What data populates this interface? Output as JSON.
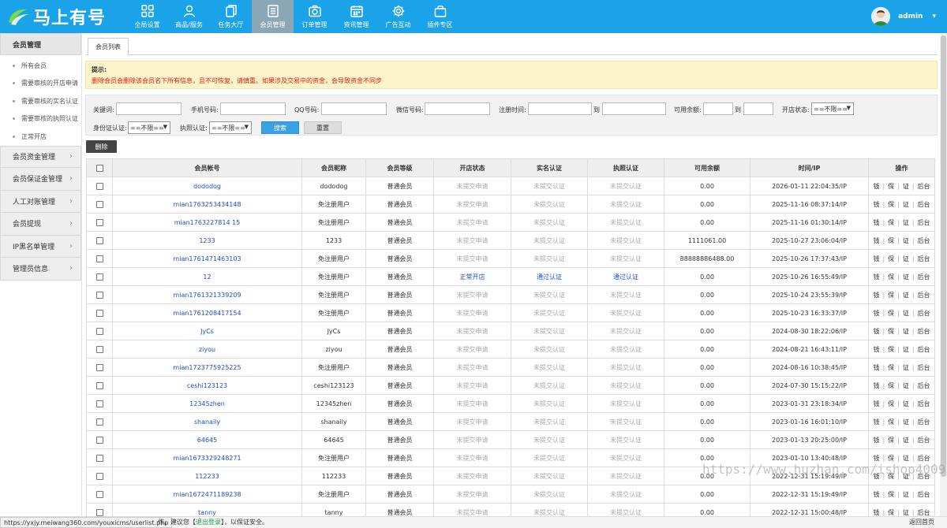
{
  "app": {
    "logo_text": "马上有号",
    "brand_color": "#1aa3e8"
  },
  "nav": [
    {
      "label": "全局设置",
      "icon": "grid-icon"
    },
    {
      "label": "商品/服务",
      "icon": "user-icon"
    },
    {
      "label": "任务大厅",
      "icon": "copy-icon"
    },
    {
      "label": "会员管理",
      "icon": "document-icon",
      "active": true
    },
    {
      "label": "订单管理",
      "icon": "camera-icon"
    },
    {
      "label": "资讯管理",
      "icon": "calendar-icon"
    },
    {
      "label": "广告互动",
      "icon": "gear-icon"
    },
    {
      "label": "插件专区",
      "icon": "bag-icon"
    }
  ],
  "user": {
    "name": "admin"
  },
  "sidebar": {
    "head": "会员管理",
    "subitems": [
      "所有会员",
      "需要审核的开店申请",
      "需要审核的实名认证",
      "需要审核的执照认证",
      "正常开店"
    ],
    "groups": [
      "会员资金管理",
      "会员保证金管理",
      "人工对账管理",
      "会员提现",
      "IP黑名单管理",
      "管理员信息"
    ]
  },
  "tab": {
    "label": "会员列表"
  },
  "notice": {
    "title": "提示:",
    "text": "删除会员会删除该会员名下所有信息，且不可恢复，请慎重。如果涉及交易中的资金，会导致资金不同步"
  },
  "filter": {
    "keyword_label": "关键词:",
    "phone_label": "手机号码:",
    "qq_label": "QQ号码:",
    "wechat_label": "微信号码:",
    "regtime_label": "注册时间:",
    "to1": "到",
    "balance_label": "可用余额:",
    "to2": "到",
    "shop_label": "开店状态:",
    "shop_value": "==不限==",
    "idcert_label": "身份证认证:",
    "idcert_value": "==不限==",
    "license_label": "执照认证:",
    "license_value": "==不限==",
    "search": "搜索",
    "reset": "重置"
  },
  "delete_label": "删除",
  "table": {
    "headers": [
      "会员帐号",
      "会员昵称",
      "会员等级",
      "开店状态",
      "实名认证",
      "执照认证",
      "可用余额",
      "时间/IP",
      "操作"
    ],
    "ops": [
      "钱",
      "保",
      "证",
      "后台"
    ],
    "rows": [
      {
        "account": "dododog",
        "nick": "dododog",
        "level": "普通会员",
        "shop": "未提交申请",
        "real": "未提交认证",
        "license": "未提交认证",
        "balance": "0.00",
        "time": "2026-01-11 22:04:35/IP"
      },
      {
        "account": "mian1763253434148",
        "nick": "免注册用户",
        "level": "普通会员",
        "shop": "未提交申请",
        "real": "未提交认证",
        "license": "未提交认证",
        "balance": "0.00",
        "time": "2025-11-16 08:37:14/IP"
      },
      {
        "account": "mian1763227814 15",
        "nick": "免注册用户",
        "level": "普通会员",
        "shop": "未提交申请",
        "real": "未提交认证",
        "license": "未提交认证",
        "balance": "0.00",
        "time": "2025-11-16 01:30:14/IP"
      },
      {
        "account": "1233",
        "nick": "1233",
        "level": "普通会员",
        "shop": "未提交申请",
        "real": "未提交认证",
        "license": "未提交认证",
        "balance": "1111061.00",
        "time": "2025-10-27 23:06:04/IP"
      },
      {
        "account": "mian1761471463103",
        "nick": "免注册用户",
        "level": "普通会员",
        "shop": "未提交申请",
        "real": "未提交认证",
        "license": "未提交认证",
        "balance": "88888886488.00",
        "time": "2025-10-26 17:37:43/IP"
      },
      {
        "account": "12",
        "nick": "免注册用户",
        "level": "普通会员",
        "shop": "正常开店",
        "real": "通过认证",
        "license": "通过认证",
        "balance": "0.00",
        "time": "2025-10-26 16:55:49/IP",
        "approved": true
      },
      {
        "account": "mian1761321339209",
        "nick": "免注册用户",
        "level": "普通会员",
        "shop": "未提交申请",
        "real": "未提交认证",
        "license": "未提交认证",
        "balance": "0.00",
        "time": "2025-10-24 23:55:39/IP"
      },
      {
        "account": "mian1761208417154",
        "nick": "免注册用户",
        "level": "普通会员",
        "shop": "未提交申请",
        "real": "未提交认证",
        "license": "未提交认证",
        "balance": "0.00",
        "time": "2025-10-23 16:33:37/IP"
      },
      {
        "account": "JyCs",
        "nick": "JyCs",
        "level": "普通会员",
        "shop": "未提交申请",
        "real": "未提交认证",
        "license": "未提交认证",
        "balance": "0.00",
        "time": "2024-08-30 18:22:06/IP"
      },
      {
        "account": "ziyou",
        "nick": "ziyou",
        "level": "普通会员",
        "shop": "未提交申请",
        "real": "未提交认证",
        "license": "未提交认证",
        "balance": "0.00",
        "time": "2024-08-21 16:43:11/IP"
      },
      {
        "account": "mian1723775925225",
        "nick": "免注册用户",
        "level": "普通会员",
        "shop": "未提交申请",
        "real": "未提交认证",
        "license": "未提交认证",
        "balance": "0.00",
        "time": "2024-08-16 10:38:45/IP"
      },
      {
        "account": "ceshi123123",
        "nick": "ceshi123123",
        "level": "普通会员",
        "shop": "未提交申请",
        "real": "未提交认证",
        "license": "未提交认证",
        "balance": "0.00",
        "time": "2024-07-30 15:15:22/IP"
      },
      {
        "account": "12345zhen",
        "nick": "12345zhen",
        "level": "普通会员",
        "shop": "未提交申请",
        "real": "未提交认证",
        "license": "未提交认证",
        "balance": "0.00",
        "time": "2023-01-31 23:18:34/IP"
      },
      {
        "account": "shanaily",
        "nick": "shanaily",
        "level": "普通会员",
        "shop": "未提交申请",
        "real": "未提交认证",
        "license": "未提交认证",
        "balance": "0.00",
        "time": "2023-01-16 16:01:10/IP"
      },
      {
        "account": "64645",
        "nick": "64645",
        "level": "普通会员",
        "shop": "未提交申请",
        "real": "未提交认证",
        "license": "未提交认证",
        "balance": "0.00",
        "time": "2023-01-13 20:25:00/IP"
      },
      {
        "account": "mian1673329248271",
        "nick": "免注册用户",
        "level": "普通会员",
        "shop": "未提交申请",
        "real": "未提交认证",
        "license": "未提交认证",
        "balance": "0.00",
        "time": "2023-01-10 13:40:48/IP"
      },
      {
        "account": "112233",
        "nick": "112233",
        "level": "普通会员",
        "shop": "未提交申请",
        "real": "未提交认证",
        "license": "未提交认证",
        "balance": "0.00",
        "time": "2022-12-31 15:19:49/IP"
      },
      {
        "account": "mian1672471189238",
        "nick": "免注册用户",
        "level": "普通会员",
        "shop": "未提交申请",
        "real": "未提交认证",
        "license": "未提交认证",
        "balance": "0.00",
        "time": "2022-12-31 15:19:49/IP"
      },
      {
        "account": "tanny",
        "nick": "tanny",
        "level": "普通会员",
        "shop": "未提交申请",
        "real": "未提交认证",
        "license": "未提交认证",
        "balance": "0.00",
        "time": "2022-12-31 15:00:48/IP"
      }
    ]
  },
  "statusbar": {
    "url": "https://yxjy.meiwang360.com/youxicms/userlist.php",
    "msg_pre": "作。建议您【",
    "msg_link": "退出登录",
    "msg_post": "】，以保证安全。",
    "back_home": "返回首页"
  },
  "watermark": "https://www.huzhan.com/ishop4009"
}
